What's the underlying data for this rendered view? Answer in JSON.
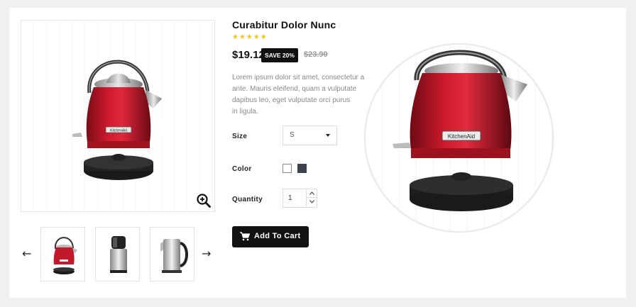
{
  "product": {
    "title": "Curabitur Dolor Nunc",
    "rating_stars": "★★★★★",
    "rating": 5,
    "price": "$19.12",
    "save_badge": "SAVE 20%",
    "old_price": "$23.90",
    "description": "Lorem ipsum dolor sit amet, consectetur a\nante. Mauris eleifend, quam a vulputate\ndapibus leo, eget vulputate orci purus\nin ligula."
  },
  "options": {
    "size_label": "Size",
    "size_value": "S",
    "color_label": "Color",
    "colors": [
      {
        "name": "white",
        "hex": "#ffffff"
      },
      {
        "name": "dark-gray",
        "hex": "#3d434c"
      }
    ],
    "quantity_label": "Quantity",
    "quantity_value": "1"
  },
  "actions": {
    "add_to_cart": "Add To Cart"
  },
  "gallery": {
    "prev_arrow": "←",
    "next_arrow": "→",
    "thumbnails": [
      "red-kettle",
      "black-grinder",
      "steel-kettle"
    ],
    "zoom_icon": "zoom-in-icon"
  },
  "colors": {
    "accent": "#111111",
    "kettle_red": "#c0192b",
    "star": "#f5c518"
  }
}
